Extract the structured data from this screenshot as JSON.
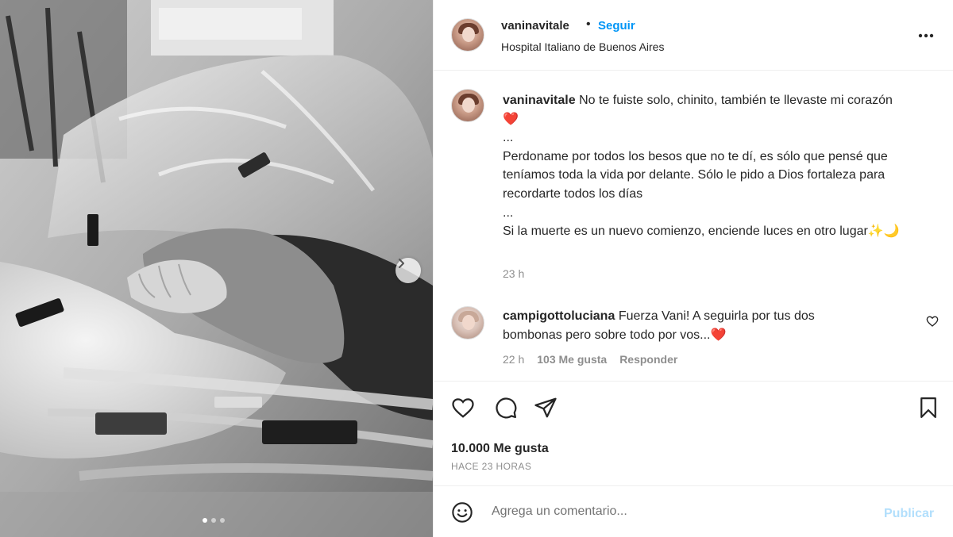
{
  "header": {
    "username": "vaninavitale",
    "separator": "•",
    "follow_label": "Seguir",
    "location": "Hospital Italiano de Buenos Aires",
    "more_icon": "more-options-icon"
  },
  "caption": {
    "username": "vaninavitale",
    "lines": [
      "No te fuiste solo, chinito, también te llevaste mi corazón ❤️",
      "...",
      "Perdoname por todos los besos que no te dí, es sólo que pensé que teníamos toda la vida por delante. Sólo le pido a Dios fortaleza para recordarte todos los días",
      "...",
      "Si la muerte es un nuevo comienzo, enciende luces en otro lugar✨🌙"
    ],
    "time": "23 h"
  },
  "comment": {
    "username": "campigottoluciana",
    "text": "Fuerza Vani! A seguirla por tus dos bombonas pero sobre todo por vos...❤️",
    "time": "22 h",
    "likes": "103 Me gusta",
    "reply_label": "Responder"
  },
  "actions": {
    "likes": "10.000 Me gusta",
    "posted": "HACE 23 HORAS"
  },
  "add_comment": {
    "placeholder": "Agrega un comentario...",
    "publish_label": "Publicar"
  },
  "carousel": {
    "slides": 3,
    "active": 1
  },
  "colors": {
    "accent": "#0095f6",
    "publish_disabled": "#b2dffc",
    "muted": "#8e8e8e",
    "text": "#262626"
  }
}
